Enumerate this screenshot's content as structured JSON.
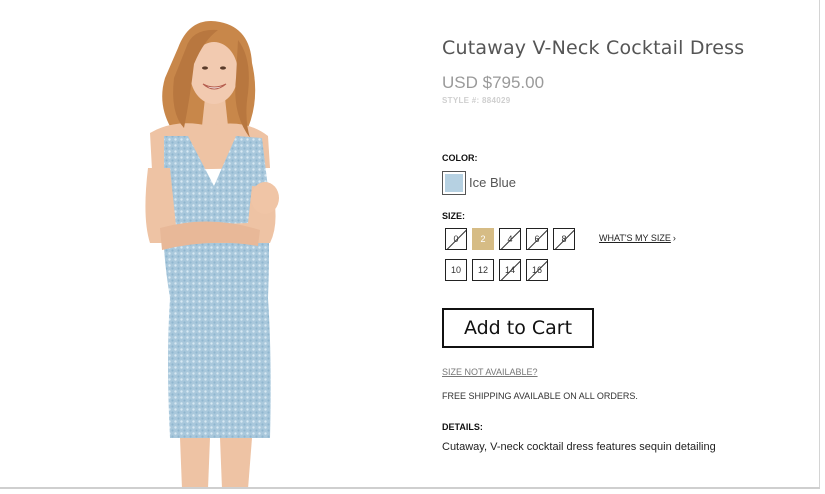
{
  "product": {
    "title": "Cutaway V-Neck Cocktail Dress",
    "price": "USD $795.00",
    "style": "STYLE #: 884029"
  },
  "color": {
    "label": "COLOR:",
    "selected_name": "Ice Blue",
    "swatch_color": "#b6d1e2"
  },
  "size": {
    "label": "SIZE:",
    "options": [
      {
        "value": "0",
        "available": false,
        "selected": false
      },
      {
        "value": "2",
        "available": true,
        "selected": true
      },
      {
        "value": "4",
        "available": false,
        "selected": false
      },
      {
        "value": "6",
        "available": false,
        "selected": false
      },
      {
        "value": "8",
        "available": false,
        "selected": false
      },
      {
        "value": "10",
        "available": true,
        "selected": false
      },
      {
        "value": "12",
        "available": true,
        "selected": false
      },
      {
        "value": "14",
        "available": false,
        "selected": false
      },
      {
        "value": "16",
        "available": false,
        "selected": false
      }
    ],
    "whats_my_size": "WHAT'S MY SIZE",
    "whats_my_size_icon": "chevron-right-icon"
  },
  "cart": {
    "add_label": "Add to Cart"
  },
  "size_not_available": "SIZE NOT AVAILABLE?",
  "shipping_note": "FREE SHIPPING AVAILABLE ON ALL ORDERS.",
  "details": {
    "label": "DETAILS:",
    "text": "Cutaway, V-neck cocktail dress features sequin detailing"
  },
  "colors": {
    "accent_selected": "#d6bc85"
  }
}
